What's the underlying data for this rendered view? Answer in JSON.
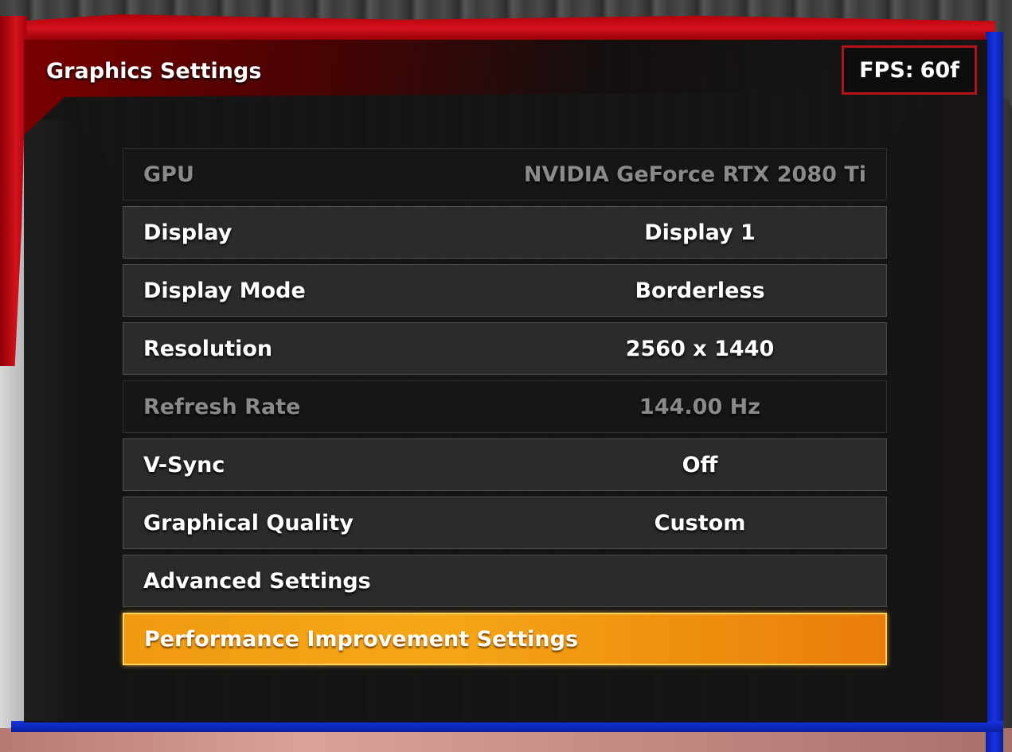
{
  "header": {
    "title": "Graphics Settings",
    "fps_label": "FPS:",
    "fps_value": "60f"
  },
  "settings": [
    {
      "label": "GPU",
      "value": "NVIDIA GeForce RTX 2080 Ti",
      "state": "disabled"
    },
    {
      "label": "Display",
      "value": "Display 1",
      "state": "normal"
    },
    {
      "label": "Display Mode",
      "value": "Borderless",
      "state": "normal"
    },
    {
      "label": "Resolution",
      "value": "2560 x 1440",
      "state": "normal"
    },
    {
      "label": "Refresh Rate",
      "value": "144.00 Hz",
      "state": "disabled"
    },
    {
      "label": "V-Sync",
      "value": "Off",
      "state": "normal"
    },
    {
      "label": "Graphical Quality",
      "value": "Custom",
      "state": "normal"
    },
    {
      "label": "Advanced Settings",
      "value": "",
      "state": "normal"
    },
    {
      "label": "Performance Improvement Settings",
      "value": "",
      "state": "selected"
    }
  ],
  "colors": {
    "selected_row": "#f5a716",
    "frame_red": "#d4121c",
    "frame_blue": "#1633e0"
  }
}
